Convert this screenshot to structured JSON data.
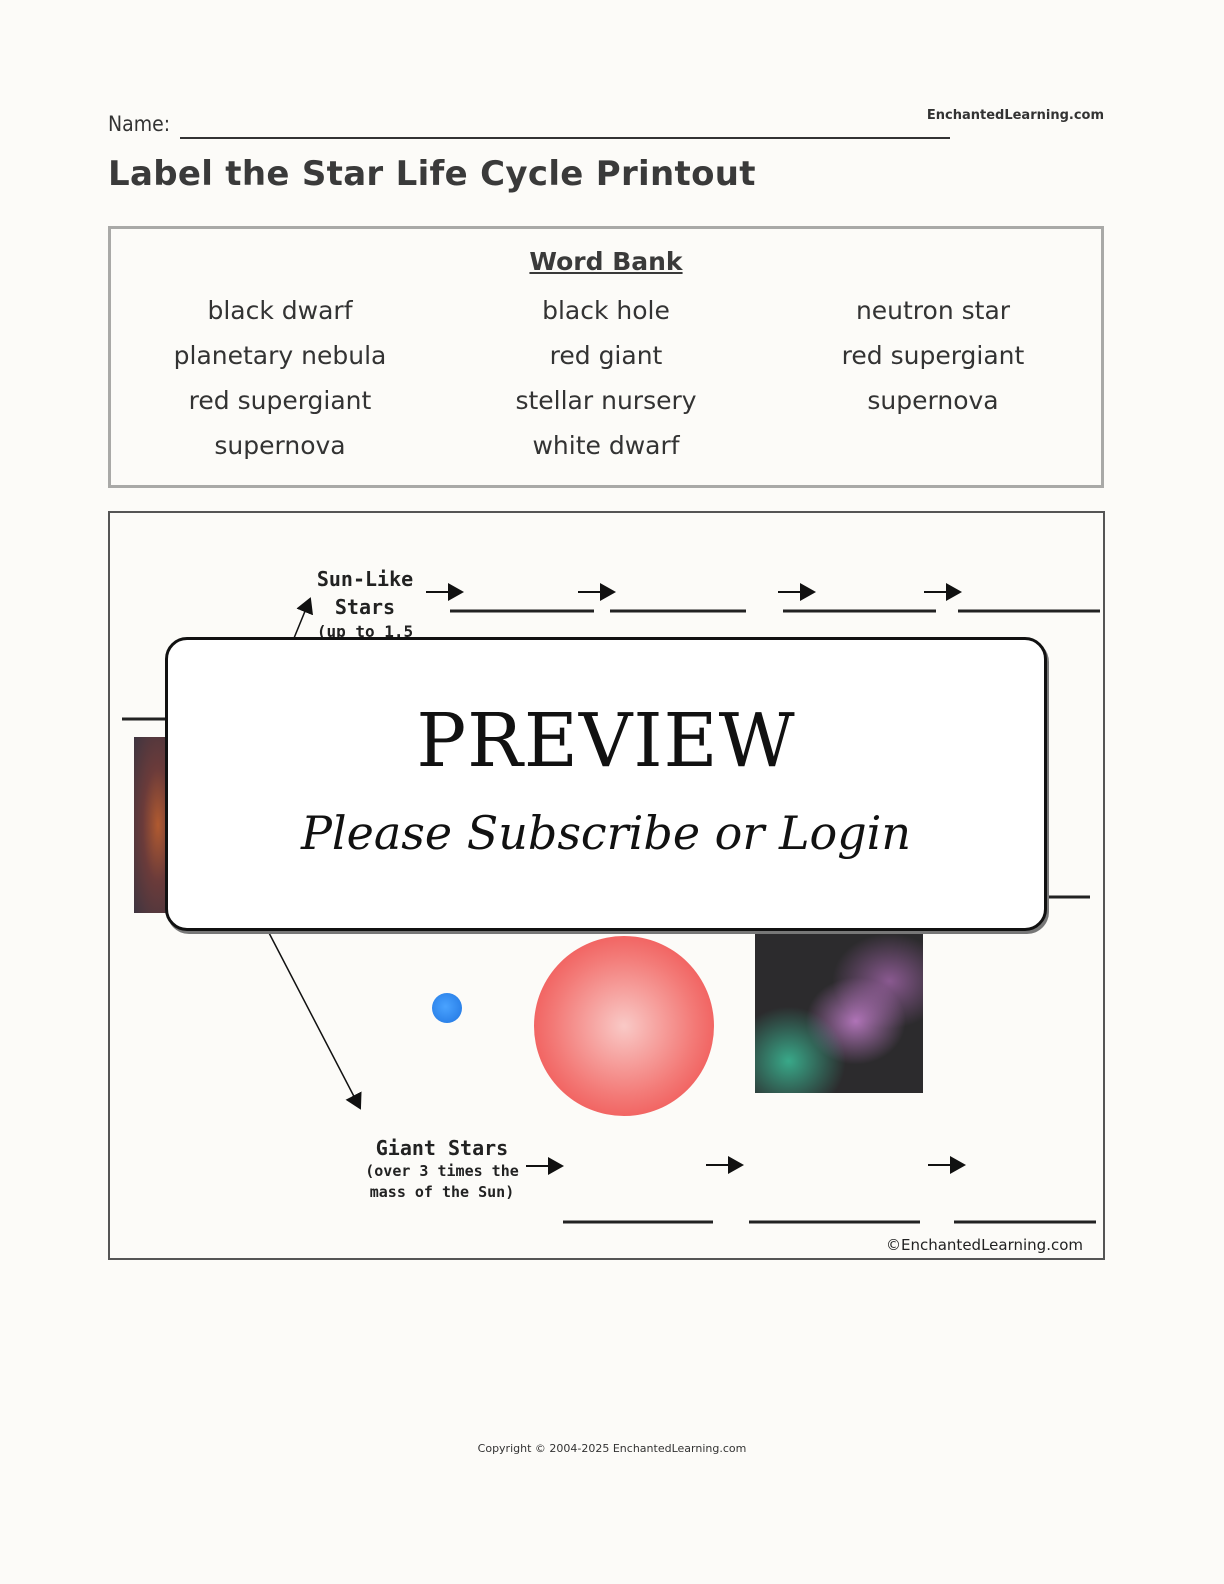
{
  "header": {
    "name_label": "Name:",
    "site": "EnchantedLearning.com",
    "title": "Label the Star Life Cycle Printout"
  },
  "word_bank": {
    "title": "Word Bank",
    "columns": [
      [
        "black dwarf",
        "planetary nebula",
        "red supergiant",
        "supernova"
      ],
      [
        "black hole",
        "red giant",
        "stellar nursery",
        "white dwarf"
      ],
      [
        "neutron star",
        "red supergiant",
        "supernova"
      ]
    ]
  },
  "diagram": {
    "sun_like": {
      "line1": "Sun-Like",
      "line2": "Stars",
      "line3": "(up to 1.5"
    },
    "giant": {
      "line1": "Giant Stars",
      "line2": "(over 3 times the",
      "line3": "mass of the Sun)"
    },
    "copyright": "©EnchantedLearning.com",
    "sun_like_blank_count": 4,
    "giant_blank_count": 3
  },
  "overlay": {
    "title": "PREVIEW",
    "subtitle": "Please Subscribe or Login"
  },
  "footer": {
    "copyright": "Copyright © 2004-2025 EnchantedLearning.com"
  }
}
